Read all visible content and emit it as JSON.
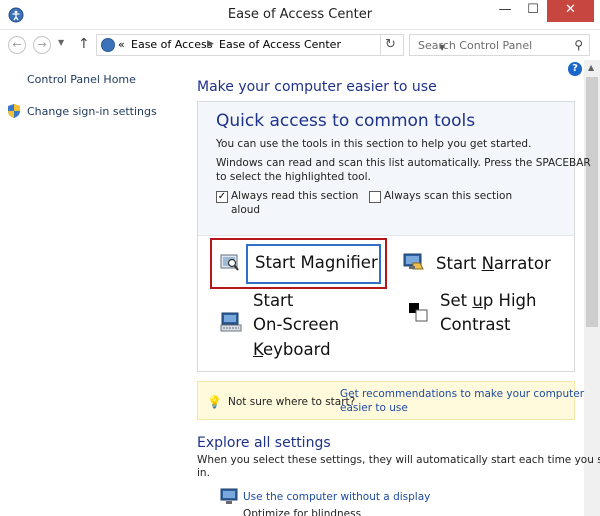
{
  "window": {
    "title": "Ease of Access Center"
  },
  "nav": {
    "breadcrumb_prefix": "«",
    "breadcrumbs": [
      "Ease of Access",
      "Ease of Access Center"
    ],
    "search_placeholder": "Search Control Panel"
  },
  "sidebar": {
    "items": [
      {
        "label": "Control Panel Home"
      },
      {
        "label": "Change sign-in settings"
      }
    ]
  },
  "main": {
    "heading": "Make your computer easier to use",
    "quick_access": {
      "title": "Quick access to common tools",
      "line1": "You can use the tools in this section to help you get started.",
      "line2": "Windows can read and scan this list automatically.  Press the SPACEBAR",
      "line3": "to select the highlighted tool.",
      "always_read": {
        "label_line1": "Always read this section",
        "label_line2": "aloud",
        "checked": true
      },
      "always_scan": {
        "label": "Always scan this section",
        "checked": false
      },
      "tools": {
        "magnifier": "Start Magnifier",
        "narrator_prefix": "Start ",
        "narrator_u": "N",
        "narrator_rest": "arrator",
        "osk_line1": "Start",
        "osk_line2": "On-Screen",
        "osk_u": "K",
        "osk_rest": "eyboard",
        "hc_prefix": "Set ",
        "hc_u": "u",
        "hc_rest": "p High",
        "hc_line2": "Contrast"
      }
    },
    "tip": {
      "text": "Not sure where to start?",
      "link_line1": "Get recommendations to make your computer",
      "link_line2": "easier to use"
    },
    "explore": {
      "heading": "Explore all settings",
      "text_line1": "When you select these settings, they will automatically start each time you sign",
      "text_line2": "in.",
      "link": "Use the computer without a display",
      "sub": "Optimize for blindness"
    }
  }
}
